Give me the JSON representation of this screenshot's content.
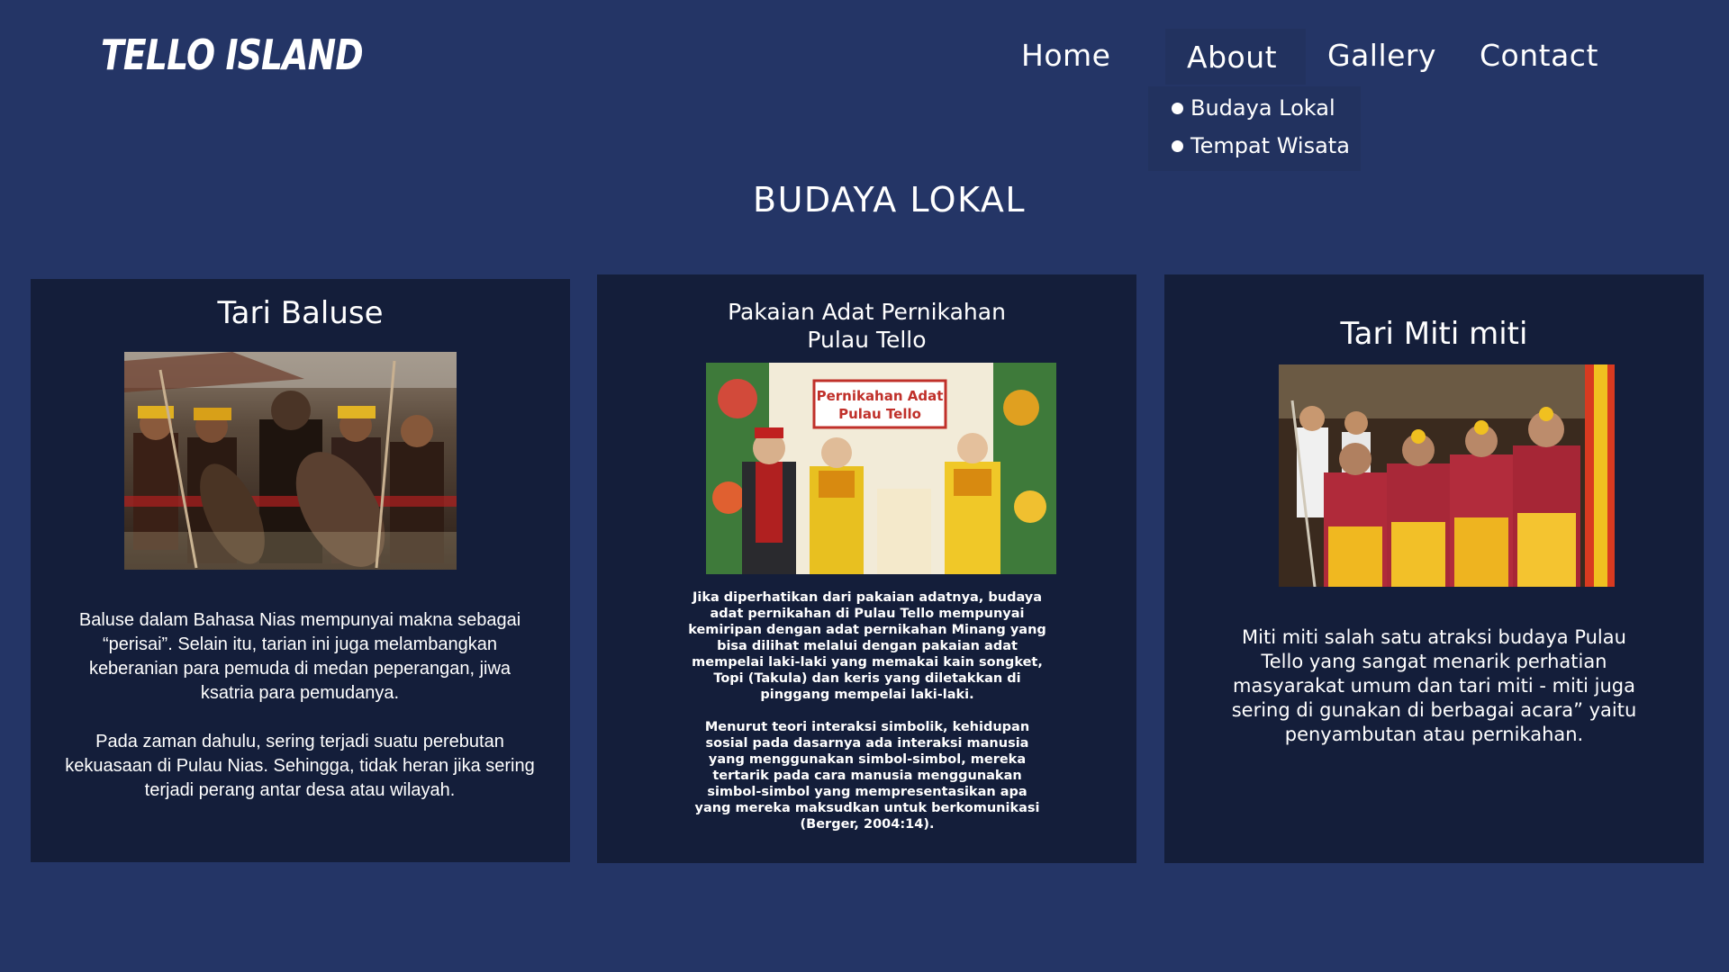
{
  "header": {
    "logo": "TELLO ISLAND",
    "nav": {
      "home": "Home",
      "about": "About",
      "gallery": "Gallery",
      "contact": "Contact"
    },
    "dropdown": [
      "Budaya Lokal",
      "Tempat Wisata"
    ]
  },
  "section_title": "BUDAYA LOKAL",
  "cards": [
    {
      "title": "Tari Baluse",
      "paragraphs": [
        "Baluse dalam Bahasa Nias mempunyai makna sebagai  “perisai”. Selain itu, tarian ini juga melambangkan keberanian para pemuda di medan peperangan, jiwa ksatria para pemudanya.",
        "Pada zaman dahulu, sering terjadi suatu perebutan kekuasaan di Pulau Nias. Sehingga, tidak heran jika sering terjadi perang antar desa atau wilayah."
      ]
    },
    {
      "title": "Pakaian Adat Pernikahan Pulau Tello",
      "image_caption": "Pernikahan Adat Pulau Tello",
      "paragraphs": [
        "Jika diperhatikan dari pakaian adatnya, budaya adat pernikahan di Pulau Tello mempunyai kemiripan dengan adat pernikahan Minang yang bisa dilihat melalui dengan pakaian adat mempelai laki-laki yang memakai kain songket, Topi (Takula) dan keris yang diletakkan di pinggang mempelai laki-laki.",
        "Menurut teori interaksi simbolik, kehidupan sosial pada dasarnya ada interaksi manusia yang menggunakan simbol-simbol, mereka tertarik pada cara manusia menggunakan simbol-simbol yang mempresentasikan apa yang mereka maksudkan untuk berkomunikasi (Berger, 2004:14)."
      ]
    },
    {
      "title": "Tari Miti miti",
      "paragraphs": [
        "Miti miti salah satu atraksi budaya Pulau Tello yang sangat menarik perhatian masyarakat umum dan tari miti - miti juga sering di gunakan di berbagai acara” yaitu penyambutan atau pernikahan."
      ]
    }
  ],
  "colors": {
    "background": "#243566",
    "card": "#141e3a",
    "text": "#ffffff",
    "dropdown": "#22325f"
  }
}
